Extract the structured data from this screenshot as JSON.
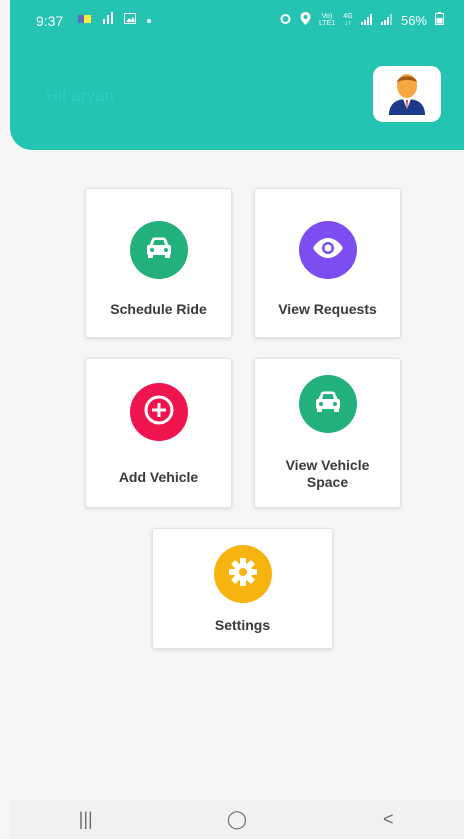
{
  "status_bar": {
    "time": "9:37",
    "left_icons": [
      "message-icon",
      "signal-bars-icon",
      "image-icon",
      "dot-icon"
    ],
    "right_icons": [
      "alarm-icon",
      "location-icon",
      "volte-icon",
      "4g-icon",
      "signal-icon",
      "signal-icon"
    ],
    "battery": "56%",
    "volte_label": "Vo))\nLTE1",
    "network_label": "4G"
  },
  "header": {
    "greeting": "Hi! aryan",
    "accent_color": "#25c3b2"
  },
  "menu": {
    "items": [
      {
        "label": "Schedule Ride",
        "icon": "car-icon",
        "color": "#22b07d"
      },
      {
        "label": "View Requests",
        "icon": "eye-icon",
        "color": "#7c4df0"
      },
      {
        "label": "Add Vehicle",
        "icon": "plus-circle-icon",
        "color": "#f0144f"
      },
      {
        "label": "View Vehicle Space",
        "icon": "car-icon",
        "color": "#22b07d"
      },
      {
        "label": "Settings",
        "icon": "gear-icon",
        "color": "#f7b40f"
      }
    ]
  },
  "nav_bar": {
    "recent": "|||",
    "home": "◯",
    "back": "<"
  }
}
